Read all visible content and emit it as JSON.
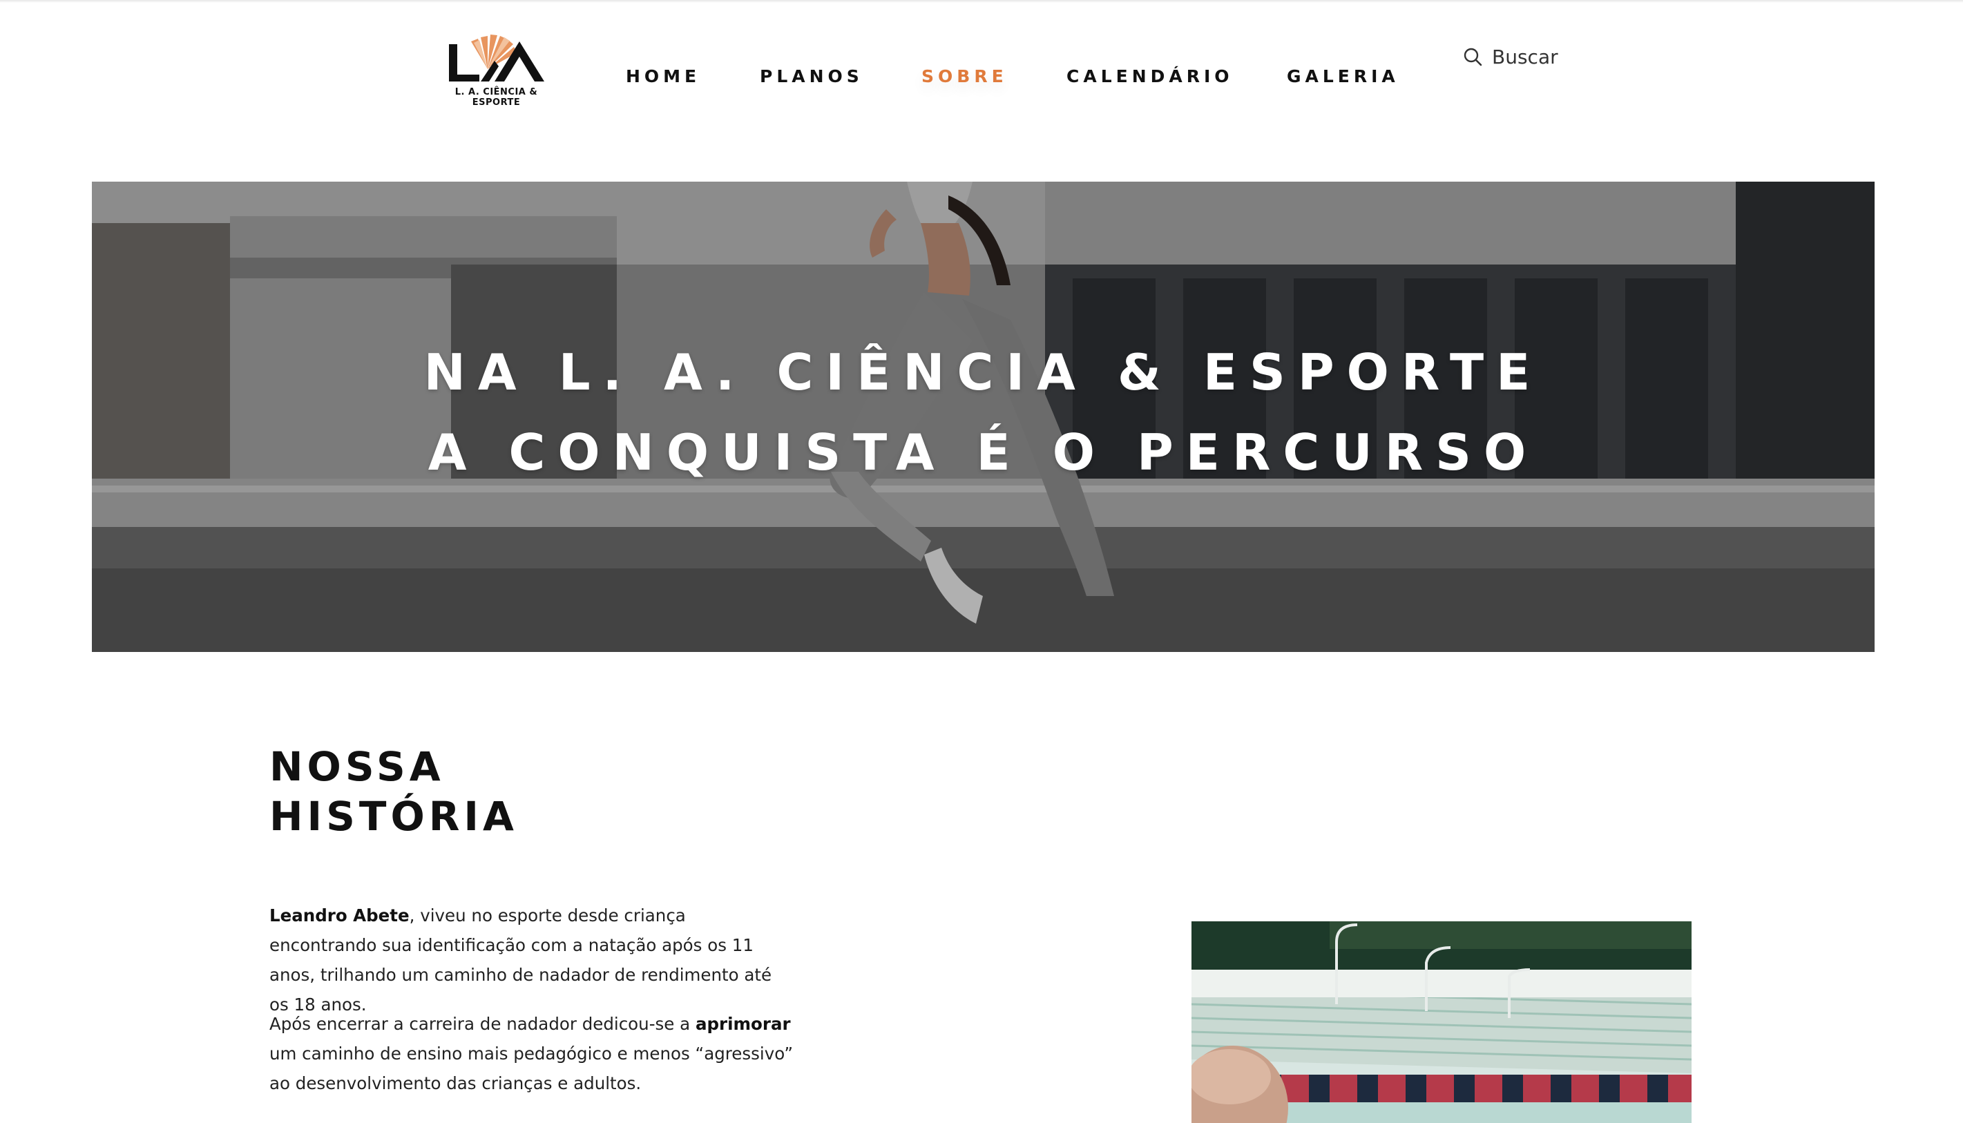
{
  "header": {
    "logo_text": "L. A. CIÊNCIA & ESPORTE",
    "nav": [
      {
        "label": "HOME",
        "active": false
      },
      {
        "label": "PLANOS",
        "active": false
      },
      {
        "label": "SOBRE",
        "active": true
      },
      {
        "label": "CALENDÁRIO",
        "active": false
      },
      {
        "label": "GALERIA",
        "active": false
      }
    ],
    "search_label": "Buscar",
    "search_icon": "search-icon"
  },
  "hero": {
    "line1": "NA L. A. CIÊNCIA & ESPORTE",
    "line2": "A CONQUISTA É O PERCURSO"
  },
  "about": {
    "title_line1": "NOSSA",
    "title_line2": "HISTÓRIA",
    "p1_bold": "Leandro Abete",
    "p1_rest": ", viveu no esporte desde criança encontrando sua identificação com a natação após os 11 anos, trilhando um caminho de nadador de rendimento até os 18 anos.",
    "p2_before": "Após encerrar a carreira de nadador dedicou-se a ",
    "p2_bold": "aprimorar",
    "p2_after": " um caminho de ensino mais pedagógico e menos “agressivo” ao desenvolvimento das crianças e adultos."
  },
  "colors": {
    "accent": "#e07a3b",
    "text": "#111111",
    "logo_orange": "#e8955f"
  }
}
